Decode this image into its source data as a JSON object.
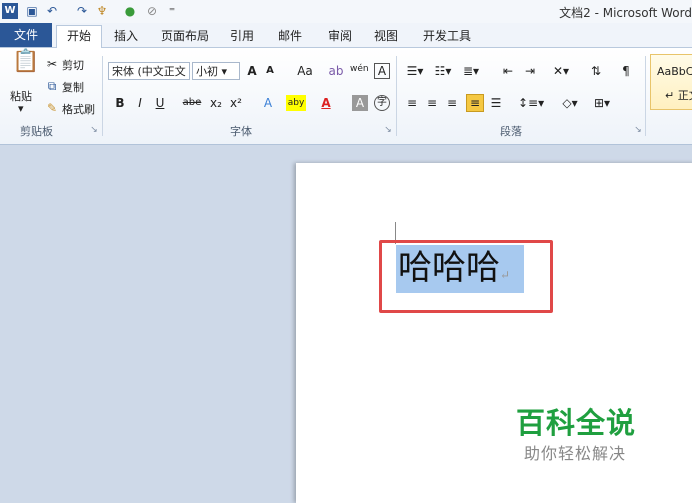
{
  "window": {
    "title": "文档2 - Microsoft Word"
  },
  "quick_access": {
    "icons": [
      "word-logo-icon",
      "save-icon",
      "undo-icon",
      "redo-icon",
      "format-painter-icon",
      "color-icon",
      "eraser-icon",
      "customize-icon"
    ]
  },
  "tabs": [
    "文件",
    "开始",
    "插入",
    "页面布局",
    "引用",
    "邮件",
    "审阅",
    "视图",
    "开发工具"
  ],
  "active_tab": "开始",
  "clipboard": {
    "paste": "粘贴",
    "cut": "剪切",
    "copy": "复制",
    "format_painter": "格式刷",
    "group": "剪贴板"
  },
  "font": {
    "name": "宋体 (中文正文",
    "size": "小初",
    "group": "字体",
    "grow": "A",
    "shrink": "A",
    "case": "Aa",
    "clear": "ab",
    "phonetic": "wén",
    "border": "A",
    "bold": "B",
    "italic": "I",
    "underline": "U",
    "strike": "abe",
    "sub": "x₂",
    "sup": "x²",
    "effects": "A",
    "highlight": "aby",
    "color": "A",
    "shade": "A",
    "enclose": "字"
  },
  "paragraph": {
    "group": "段落"
  },
  "styles": {
    "preview": "AaBbC",
    "name": "正文"
  },
  "document": {
    "text": "哈哈哈"
  },
  "watermark": {
    "line1": "百科全说",
    "line2": "助你轻松解决"
  }
}
